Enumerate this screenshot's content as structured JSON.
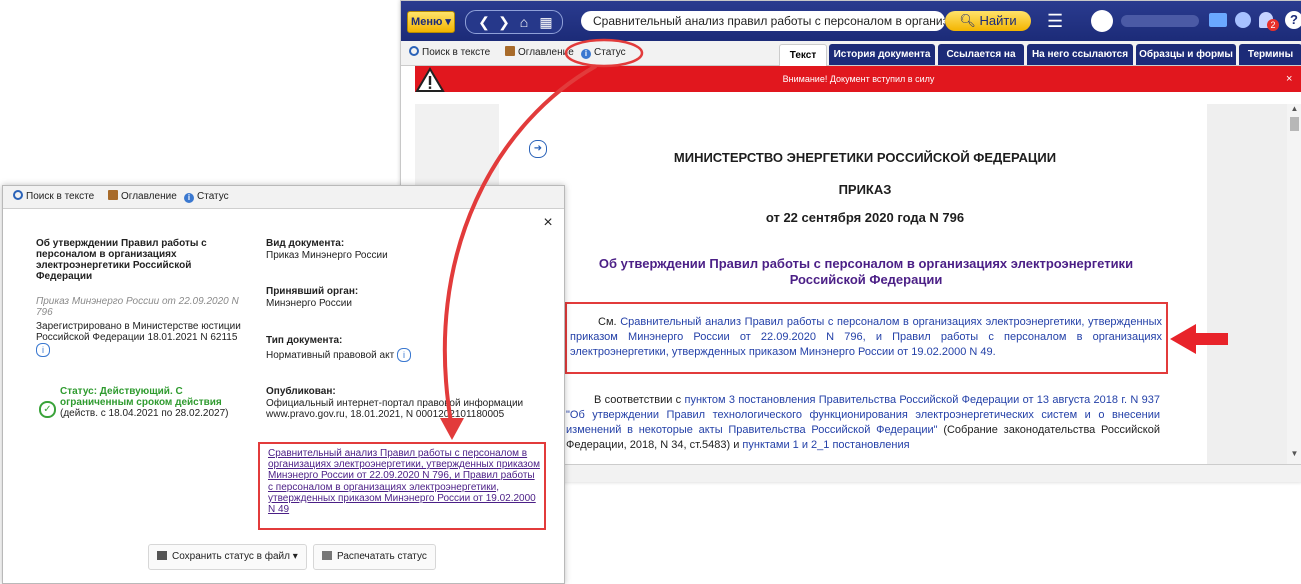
{
  "topbar": {
    "menu_label": "Меню",
    "search_value": "Сравнительный анализ правил работы с персоналом в организациях :",
    "find_label": "Найти",
    "notification_count": "2"
  },
  "toolbar": {
    "search_in_text": "Поиск в тексте",
    "contents": "Оглавление",
    "status": "Статус"
  },
  "tabs": [
    {
      "label": "Текст",
      "active": true
    },
    {
      "label": "История документа"
    },
    {
      "label": "Ссылается на"
    },
    {
      "label": "На него ссылаются"
    },
    {
      "label": "Образцы и формы"
    },
    {
      "label": "Термины"
    }
  ],
  "status_bar": {
    "message": "Внимание! Документ вступил в силу",
    "close": "×"
  },
  "document": {
    "ministry": "МИНИСТЕРСТВО ЭНЕРГЕТИКИ РОССИЙСКОЙ ФЕДЕРАЦИИ",
    "order": "ПРИКАЗ",
    "date_number": "от 22 сентября 2020 года N 796",
    "title": "Об утверждении Правил работы с персоналом в организациях электроэнергетики Российской Федерации",
    "see_prefix": "См.",
    "see_link": "Сравнительный анализ Правил работы с персоналом в организациях электроэнергетики, утвержденных приказом Минэнерго России от 22.09.2020 N 796, и Правил работы с персоналом в организациях электроэнергетики, утвержденных приказом Минэнерго России от 19.02.2000 N 49.",
    "p2_a": "В соответствии с",
    "p2_link1": "пунктом 3 постановления Правительства Российской Федерации от 13 августа 2018 г. N 937 \"Об утверждении Правил технологического функционирования электроэнергетических систем и о внесении изменений в некоторые акты Правительства Российской Федерации\"",
    "p2_b": "(Собрание законодательства Российской Федерации, 2018, N 34, ст.5483) и",
    "p2_link2": "пунктами 1 и 2_1 постановления"
  },
  "popup": {
    "toolbar": {
      "search_in_text": "Поиск в тексте",
      "contents": "Оглавление",
      "status": "Статус"
    },
    "close": "×",
    "doc_title": "Об утверждении Правил работы с персоналом в организациях электроэнергетики Российской Федерации",
    "doc_source": "Приказ Минэнерго России от 22.09.2020 N 796",
    "registered": "Зарегистрировано в Министерстве юстиции Российской Федерации 18.01.2021 N 62115",
    "status_label": "Статус: Действующий. С ограниченным сроком действия",
    "status_period": "(действ. с 18.04.2021 по 28.02.2027)",
    "doc_type_label": "Вид документа:",
    "doc_type_value": "Приказ Минэнерго России",
    "issuer_label": "Принявший орган:",
    "issuer_value": "Минэнерго России",
    "type_label": "Тип документа:",
    "type_value": "Нормативный правовой акт",
    "published_label": "Опубликован:",
    "published_value": "Официальный интернет-портал правовой информации www.pravo.gov.ru, 18.01.2021, N 0001202101180005",
    "related_link": "Сравнительный анализ Правил работы с персоналом в организациях электроэнергетики, утвержденных приказом Минэнерго России от 22.09.2020 N 796, и Правил работы с персоналом в организациях электроэнергетики, утвержденных приказом Минэнерго России от 19.02.2000 N 49",
    "save_button": "Сохранить статус в файл",
    "print_button": "Распечатать статус"
  },
  "colors": {
    "topbar": "#1c2b78",
    "accent_yellow": "#f3b400",
    "alert_red": "#e1171e",
    "link_blue": "#2441a8",
    "title_purple": "#4b1f86",
    "highlight_red": "#e23b3b"
  },
  "icons": [
    "warning-icon",
    "search-icon",
    "book-icon",
    "info-icon",
    "hamburger-icon",
    "user-icon",
    "folder-icon",
    "clock-icon",
    "bell-icon",
    "help-icon",
    "check-circle-icon",
    "save-icon",
    "print-icon"
  ]
}
